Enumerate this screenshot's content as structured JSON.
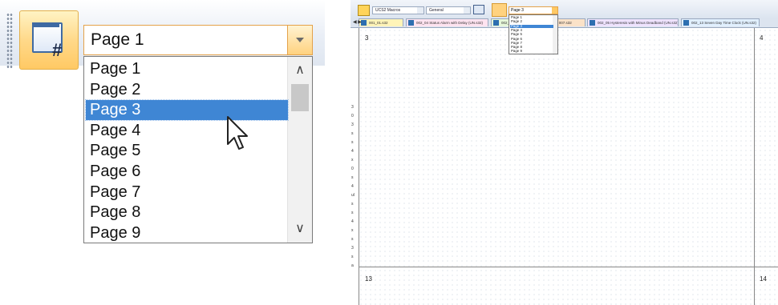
{
  "zoom": {
    "page_combo": {
      "value": "Page 1"
    },
    "page_list": {
      "items": [
        "Page 1",
        "Page 2",
        "Page 3",
        "Page 4",
        "Page 5",
        "Page 6",
        "Page 7",
        "Page 8",
        "Page 9"
      ],
      "selected_index": 2,
      "scroll_up_glyph": "∧",
      "scroll_down_glyph": "∨"
    },
    "page_icon_symbol": "#"
  },
  "app": {
    "toolbar": {
      "macros_combo": "UCS2 Macros",
      "general_combo": "General",
      "page_combo": "Page 3"
    },
    "mini_list": [
      "Page 1",
      "Page 2",
      "Page 3",
      "Page 4",
      "Page 5",
      "Page 6",
      "Page 7",
      "Page 8",
      "Page 9"
    ],
    "mini_selected_index": 2,
    "tabs": [
      "001_01.s32",
      "002_04 Status Alarm with Delay (UN.s32)",
      "002_",
      "e 007.s32",
      "002_05 Hysteresis with Minus Deadband (UN.s32)",
      "002_13 Seven Day Time Clock (UN.s32)"
    ],
    "page_numbers": {
      "top_left": "3",
      "top_right": "4",
      "bottom_left": "13",
      "bottom_right": "14"
    },
    "left_strip_chars": [
      "3",
      "0",
      "3",
      "s",
      "s",
      "4",
      "x",
      "0",
      "s",
      "4",
      "ul",
      "s",
      "s",
      "4",
      "x",
      "s",
      "3",
      "s",
      "a"
    ]
  }
}
